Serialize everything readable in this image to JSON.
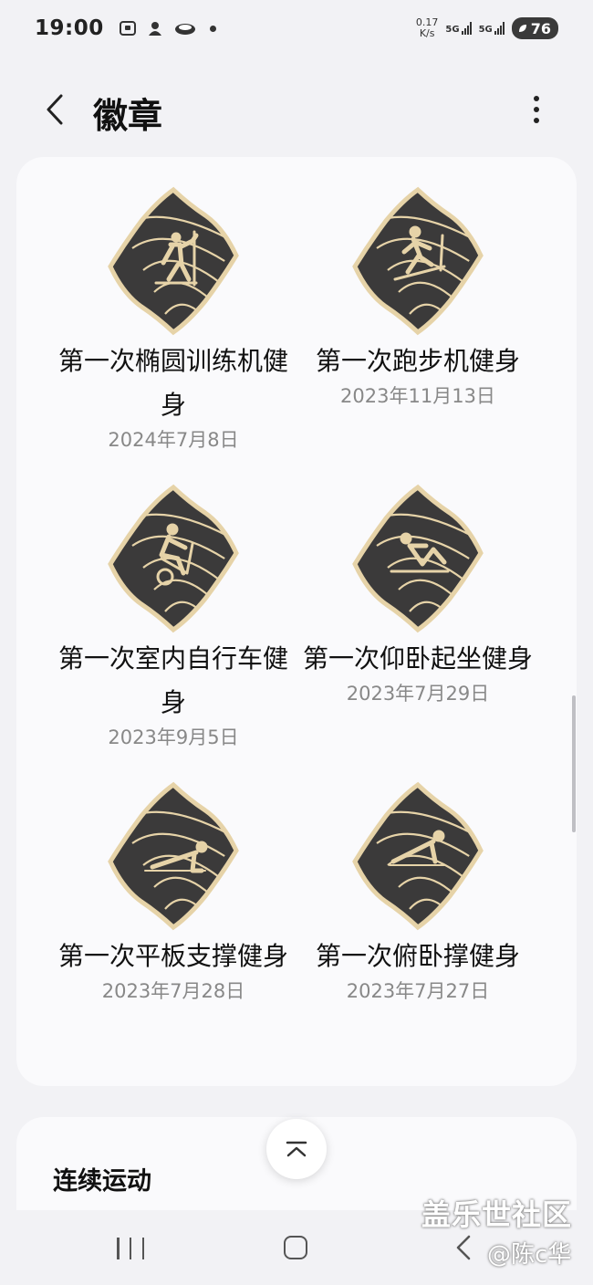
{
  "status_bar": {
    "time": "19:00",
    "net_speed_value": "0.17",
    "net_speed_unit": "K/s",
    "signal_1": "5G",
    "signal_2": "5G",
    "battery": "76"
  },
  "app_bar": {
    "title": "徽章",
    "back_icon": "chevron-left-icon",
    "more_icon": "more-vertical-icon"
  },
  "badges": [
    {
      "title": "第一次椭圆训练机健身",
      "date": "2024年7月8日",
      "icon": "elliptical-trainer-icon"
    },
    {
      "title": "第一次跑步机健身",
      "date": "2023年11月13日",
      "icon": "treadmill-icon"
    },
    {
      "title": "第一次室内自行车健身",
      "date": "2023年9月5日",
      "icon": "indoor-bike-icon"
    },
    {
      "title": "第一次仰卧起坐健身",
      "date": "2023年7月29日",
      "icon": "situp-icon"
    },
    {
      "title": "第一次平板支撑健身",
      "date": "2023年7月28日",
      "icon": "plank-icon"
    },
    {
      "title": "第一次俯卧撑健身",
      "date": "2023年7月27日",
      "icon": "pushup-icon"
    }
  ],
  "streak_section": {
    "title": "连续运动"
  },
  "scroll_to_top_icon": "chevron-up-icon",
  "watermark": {
    "brand": "盖乐世社区",
    "user": "@陈c华"
  },
  "colors": {
    "background": "#f2f2f5",
    "card": "#fafafc",
    "badge_dark": "#3b3a3a",
    "badge_gold": "#e6d3a8",
    "date_text": "#888888"
  }
}
